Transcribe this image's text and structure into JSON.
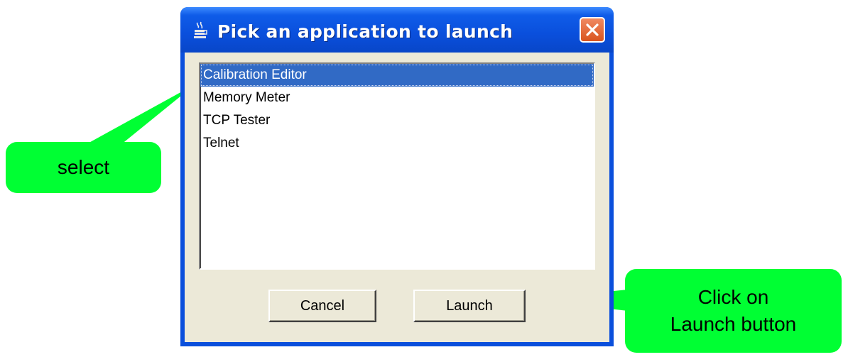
{
  "window": {
    "title": "Pick an application to launch",
    "title_icon": "java-cup-icon",
    "close_icon": "close-x-icon"
  },
  "list": {
    "items": [
      {
        "label": "Calibration Editor",
        "selected": true
      },
      {
        "label": "Memory Meter",
        "selected": false
      },
      {
        "label": "TCP Tester",
        "selected": false
      },
      {
        "label": "Telnet",
        "selected": false
      }
    ]
  },
  "buttons": {
    "cancel_label": "Cancel",
    "launch_label": "Launch"
  },
  "annotations": {
    "select_label": "select",
    "launch_line1": "Click on",
    "launch_line2": "Launch button",
    "callout_color": "#00ff33"
  },
  "colors": {
    "titlebar": "#0a4fdc",
    "selection": "#316ac5",
    "dialog_face": "#ece9d8"
  }
}
